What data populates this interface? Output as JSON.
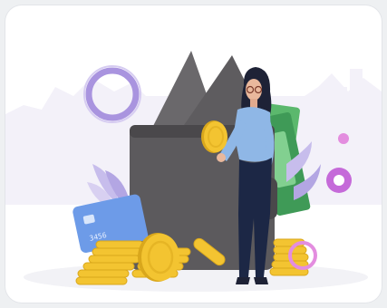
{
  "illustration": {
    "subject": "woman-holding-coin-beside-wallet",
    "card_number_fragment": "3456",
    "colors": {
      "background": "#ffffff",
      "skyline": "#f1eff8",
      "wallet": "#5c5a5d",
      "wallet_shadow": "#4a484b",
      "card_pocket": "#7c7a7d",
      "bill_green": "#5bb86d",
      "bill_green_dark": "#3f9a57",
      "coin_gold": "#f3c431",
      "coin_shadow": "#d9a71c",
      "shirt": "#8fb7e6",
      "trousers": "#1c2745",
      "hair": "#1e2236",
      "ring_purple": "#9a84d9",
      "accent_pink": "#d26ee0",
      "leaf_lavender": "#c9bfe8",
      "credit_card": "#6d9be8"
    }
  }
}
